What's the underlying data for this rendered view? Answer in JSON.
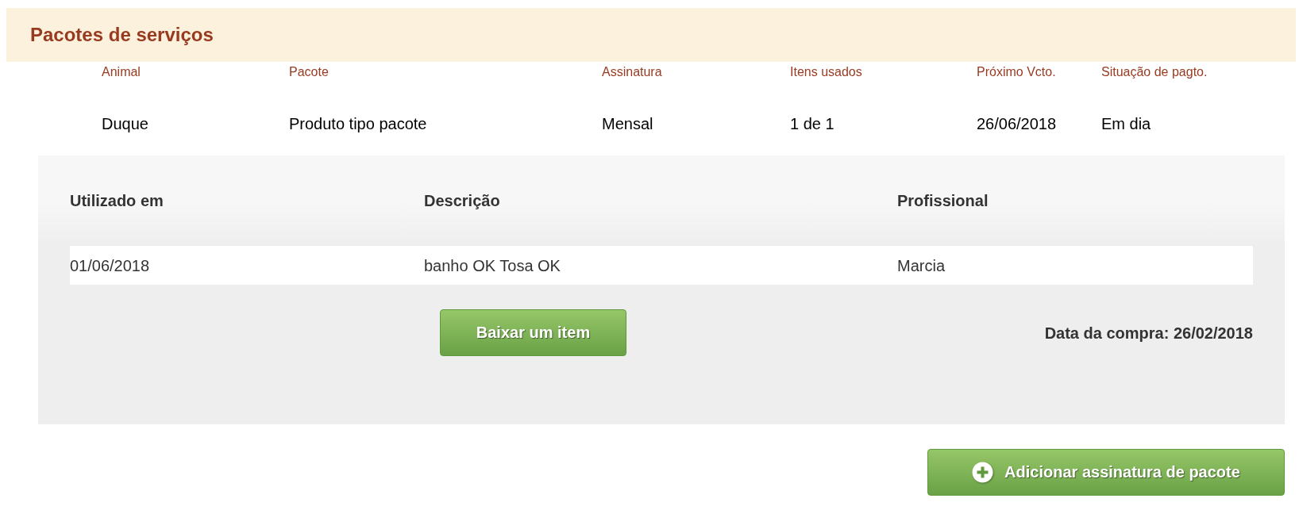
{
  "section": {
    "title": "Pacotes de serviços"
  },
  "packages": {
    "columns": [
      "Animal",
      "Pacote",
      "Assinatura",
      "Itens usados",
      "Próximo Vcto.",
      "Situação de pagto."
    ],
    "rows": [
      {
        "cells": [
          "Duque",
          "Produto tipo pacote",
          "Mensal",
          "1 de 1",
          "26/06/2018",
          "Em dia"
        ]
      }
    ]
  },
  "usage": {
    "columns": [
      "Utilizado em",
      "Descrição",
      "Profissional"
    ],
    "rows": [
      {
        "cells": [
          "01/06/2018",
          "banho OK Tosa OK",
          "Marcia"
        ]
      }
    ],
    "action_button": {
      "label": "Baixar um item"
    },
    "purchase_date": "Data da compra: 26/02/2018"
  },
  "add_button": {
    "label": "Adicionar assinatura de pacote"
  }
}
